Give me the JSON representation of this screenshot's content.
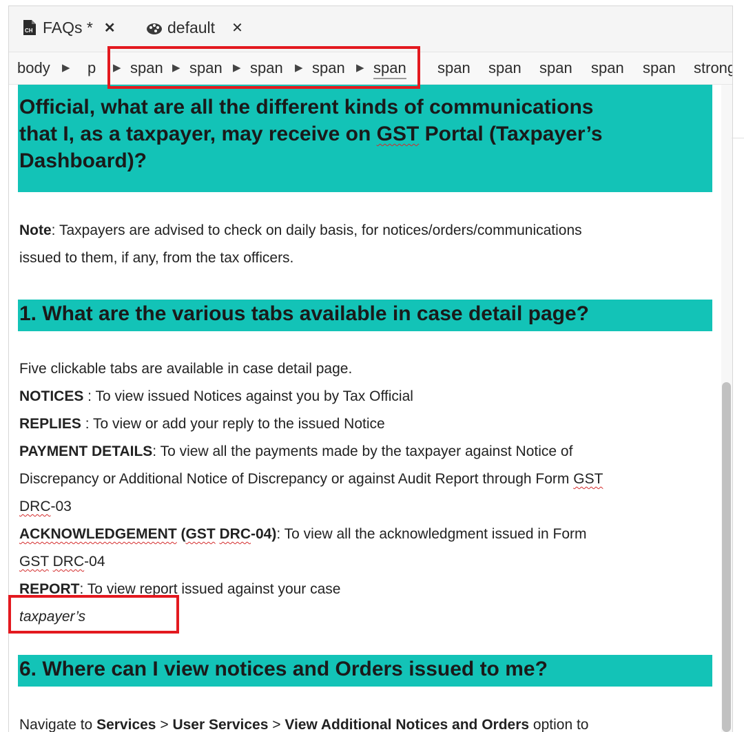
{
  "tabs": [
    {
      "label": "FAQs *",
      "close": "✕",
      "icon": "document-cn-icon"
    },
    {
      "label": "default",
      "close": "✕",
      "icon": "palette-icon"
    }
  ],
  "breadcrumb": [
    "body",
    "p",
    "span",
    "span",
    "span",
    "span",
    "span",
    "span",
    "span",
    "span",
    "span",
    "span",
    "strong"
  ],
  "heading_top": {
    "line2": "Official, what are all the different kinds of communications",
    "line3a": "that I, as a taxpayer, may receive on ",
    "line3b": "GST",
    "line3c": " Portal (Taxpayer’s",
    "line4": "Dashboard)?"
  },
  "note": {
    "label": "Note",
    "text1": ": Taxpayers are advised to check on daily basis, for notices/orders/communications",
    "text2": "issued to them, if any, from the tax officers."
  },
  "heading1": "1. What are the various tabs available in case detail page?",
  "tabs_desc": {
    "intro": "Five clickable tabs are available in case detail page.",
    "notices_label": "NOTICES",
    "notices_text": " : To view issued Notices against you by Tax Official",
    "replies_label": "REPLIES",
    "replies_text": " : To view or add your reply to the issued Notice",
    "payment_label": "PAYMENT DETAILS",
    "payment_text": ": To view all the payments made by the taxpayer against Notice of",
    "payment_line2a": "Discrepancy or Additional Notice of Discrepancy or against Audit Report through Form ",
    "payment_line2b": "GST",
    "payment_line3a": "DRC",
    "payment_line3b": "-03",
    "ack_label_a": "ACKNOWLEDGEMENT",
    "ack_label_b": " (",
    "ack_label_c": "GST",
    "ack_label_d": " ",
    "ack_label_e": "DRC",
    "ack_label_f": "-04)",
    "ack_text": ": To view all the acknowledgment issued in Form",
    "ack_line2a": "GST",
    "ack_line2b": " ",
    "ack_line2c": "DRC",
    "ack_line2d": "-04",
    "report_label": "REPORT",
    "report_text": ": To view report issued against your case",
    "italic": "taxpayer’s"
  },
  "heading6": "6. Where can I view notices and Orders issued to me?",
  "navigate": {
    "t1": "Navigate to ",
    "b1": "Services",
    "t2": " > ",
    "b2": "User Services",
    "t3": " > ",
    "b3": "View Additional Notices and Orders",
    "t4": " option to"
  },
  "colors": {
    "heading_band": "#13c3b7",
    "highlight": "#e3191f"
  }
}
